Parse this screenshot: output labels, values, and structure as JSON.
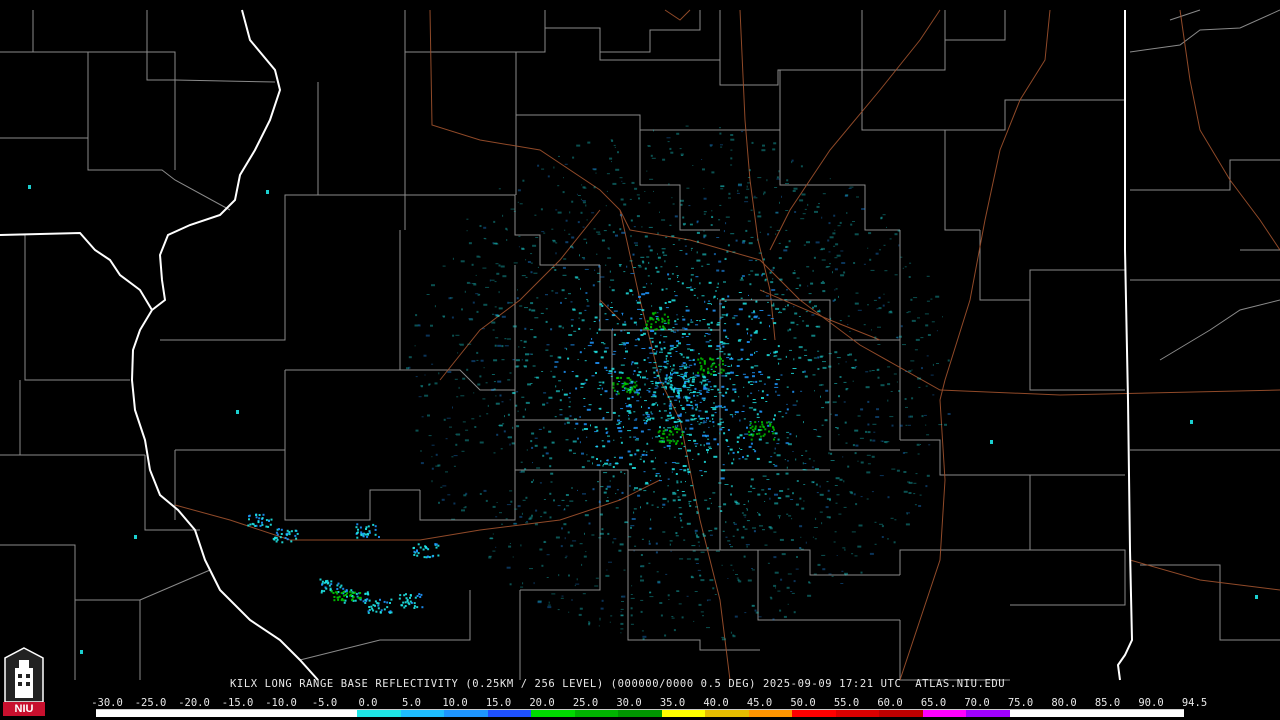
{
  "product": {
    "caption": "KILX LONG RANGE BASE REFLECTIVITY (0.25KM / 256 LEVEL) (000000/0000 0.5 DEG) 2025-09-09 17:21 UTC  ATLAS.NIU.EDU"
  },
  "logo": {
    "text": "NIU",
    "color": "#c8102e"
  },
  "colorbar": {
    "ticks": [
      "-30.0",
      "-25.0",
      "-20.0",
      "-15.0",
      "-10.0",
      "-5.0",
      "0.0",
      "5.0",
      "10.0",
      "15.0",
      "20.0",
      "25.0",
      "30.0",
      "35.0",
      "40.0",
      "45.0",
      "50.0",
      "55.0",
      "60.0",
      "65.0",
      "70.0",
      "75.0",
      "80.0",
      "85.0",
      "90.0",
      "94.5"
    ],
    "colors": [
      "#ffffff",
      "#ffffff",
      "#ffffff",
      "#ffffff",
      "#ffffff",
      "#ffffff",
      "#1ee6e6",
      "#1ebeff",
      "#1e96ff",
      "#1e50ff",
      "#00dc00",
      "#00b400",
      "#009600",
      "#ffff00",
      "#e6be00",
      "#ff9600",
      "#ff0000",
      "#dc0000",
      "#be0000",
      "#ff00ff",
      "#a000ff",
      "#ffffff",
      "#ffffff",
      "#ffffff",
      "#ffffff"
    ]
  },
  "map_colors": {
    "county_line": "#9a9a9a",
    "state_line": "#ffffff",
    "highway": "#a0522d",
    "echo_light": "#1ee6e6",
    "echo_mid": "#1e96ff",
    "echo_green": "#00c800"
  }
}
